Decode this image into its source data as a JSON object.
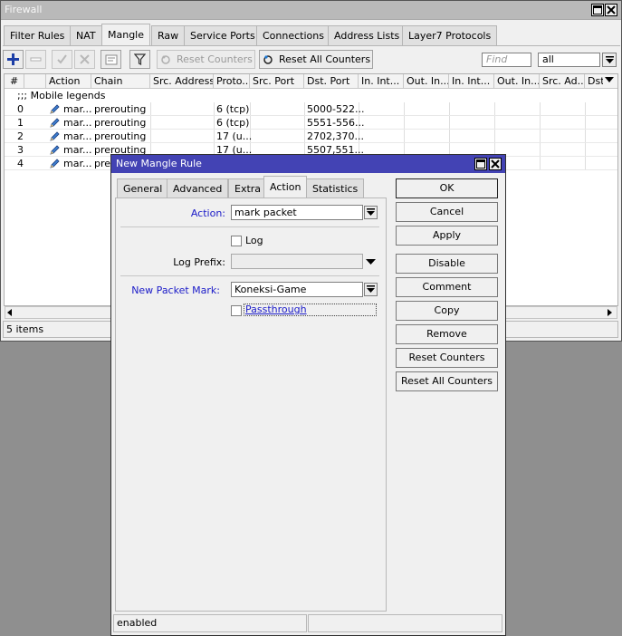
{
  "firewall": {
    "title": "Firewall",
    "tabs": [
      "Filter Rules",
      "NAT",
      "Mangle",
      "Raw",
      "Service Ports",
      "Connections",
      "Address Lists",
      "Layer7 Protocols"
    ],
    "active_tab": "Mangle",
    "toolbar": {
      "reset_counters": "Reset Counters",
      "reset_all_counters": "Reset All Counters",
      "find_placeholder": "Find",
      "filter_value": "all"
    },
    "columns": [
      "#",
      "Action",
      "Chain",
      "Src. Address",
      "Proto...",
      "Src. Port",
      "Dst. Port",
      "In. Int...",
      "Out. In...",
      "In. Int...",
      "Out. In...",
      "Src. Ad...",
      "Dst"
    ],
    "comment_row": ";;; Mobile legends",
    "rows": [
      {
        "num": "0",
        "action": "mar...",
        "chain": "prerouting",
        "proto": "6 (tcp)",
        "dst_port": "5000-522..."
      },
      {
        "num": "1",
        "action": "mar...",
        "chain": "prerouting",
        "proto": "6 (tcp)",
        "dst_port": "5551-556..."
      },
      {
        "num": "2",
        "action": "mar...",
        "chain": "prerouting",
        "proto": "17 (u...",
        "dst_port": "2702,370..."
      },
      {
        "num": "3",
        "action": "mar...",
        "chain": "prerouting",
        "proto": "17 (u...",
        "dst_port": "5507,551..."
      },
      {
        "num": "4",
        "action": "mar...",
        "chain": "prer",
        "proto": "",
        "dst_port": ""
      }
    ],
    "status": "5 items"
  },
  "dialog": {
    "title": "New Mangle Rule",
    "tabs": [
      "General",
      "Advanced",
      "Extra",
      "Action",
      "Statistics"
    ],
    "active_tab": "Action",
    "action_label": "Action:",
    "action_value": "mark packet",
    "log_label": "Log",
    "log_prefix_label": "Log Prefix:",
    "log_prefix_value": "",
    "new_packet_mark_label": "New Packet Mark:",
    "new_packet_mark_value": "Koneksi-Game",
    "passthrough_label": "Passthrough",
    "buttons": [
      "OK",
      "Cancel",
      "Apply",
      "Disable",
      "Comment",
      "Copy",
      "Remove",
      "Reset Counters",
      "Reset All Counters"
    ],
    "status_left": "enabled",
    "status_right": ""
  },
  "colors": {
    "dialog_titlebar": "#4343b4",
    "inactive_titlebar": "#b9b9b9",
    "label_blue": "#1a1ac8",
    "add_icon": "#1c3ea6"
  }
}
